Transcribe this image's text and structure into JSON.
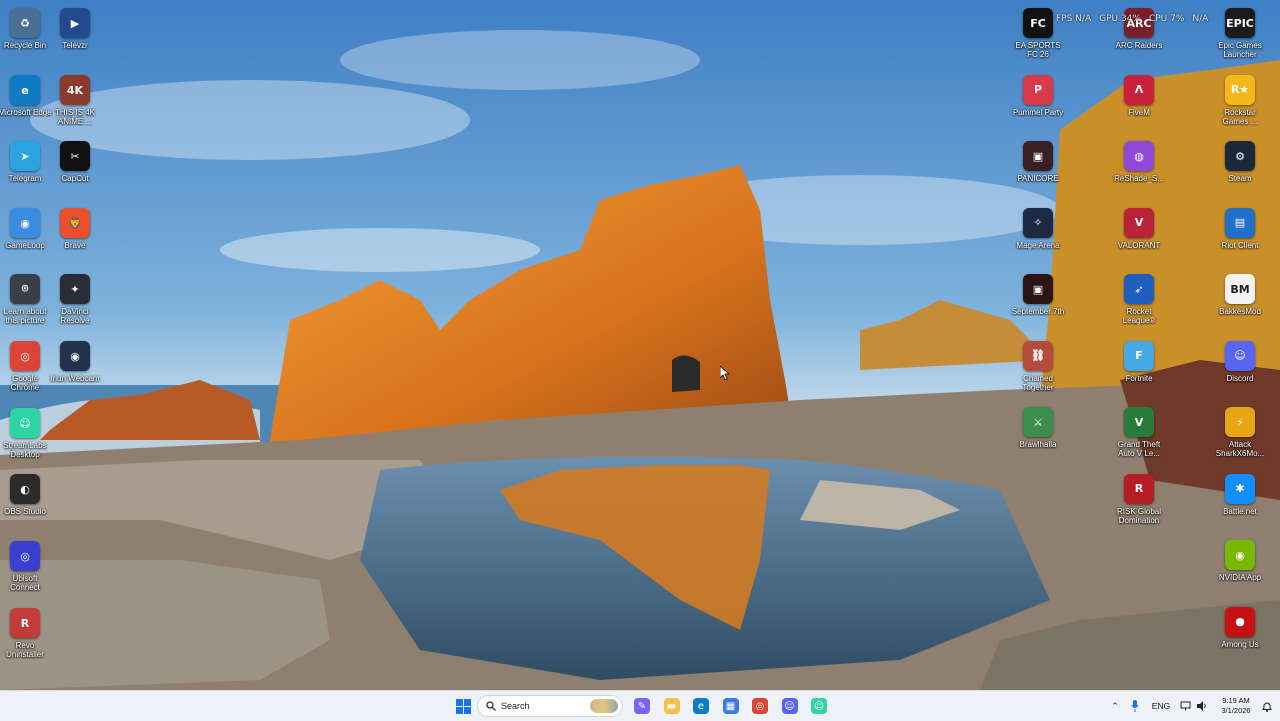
{
  "desktop": {
    "icons_left": [
      {
        "label": "Recycle Bin",
        "icon": "recycle-bin-icon",
        "color": "#4a6f92",
        "glyph": "♻"
      },
      {
        "label": "Televzr",
        "icon": "televzr-icon",
        "color": "#234a8c",
        "glyph": "▶"
      },
      {
        "label": "Microsoft Edge",
        "icon": "edge-icon",
        "color": "#0f7bc4",
        "glyph": "e"
      },
      {
        "label": "THIS IS 4K ANIME ...",
        "icon": "anime-video-icon",
        "color": "#8a3b2c",
        "glyph": "4K"
      },
      {
        "label": "Telegram",
        "icon": "telegram-icon",
        "color": "#2aa3de",
        "glyph": "➤"
      },
      {
        "label": "CapCut",
        "icon": "capcut-icon",
        "color": "#111111",
        "glyph": "✂"
      },
      {
        "label": "GameLoop",
        "icon": "gameloop-icon",
        "color": "#3b8be0",
        "glyph": "◉"
      },
      {
        "label": "Brave",
        "icon": "brave-icon",
        "color": "#e8502d",
        "glyph": "🦁"
      },
      {
        "label": "Learn about this picture",
        "icon": "camera-icon",
        "color": "#3a3f47",
        "glyph": "⌾"
      },
      {
        "label": "DaVinci Resolve",
        "icon": "davinci-resolve-icon",
        "color": "#2c2c38",
        "glyph": "✦"
      },
      {
        "label": "Google Chrome",
        "icon": "chrome-icon",
        "color": "#db4437",
        "glyph": "◎"
      },
      {
        "label": "Iriun Webcam",
        "icon": "webcam-icon",
        "color": "#22324a",
        "glyph": "◉"
      },
      {
        "label": "StreamLabs Desktop",
        "icon": "streamlabs-icon",
        "color": "#2fd4a3",
        "glyph": "☺"
      },
      {
        "label": "OBS Studio",
        "icon": "obs-icon",
        "color": "#2b2b2b",
        "glyph": "◐"
      },
      {
        "label": "Ubisoft Connect",
        "icon": "ubisoft-icon",
        "color": "#3a3fd0",
        "glyph": "◎"
      },
      {
        "label": "Revo Uninstaller",
        "icon": "revo-uninstaller-icon",
        "color": "#c43b3b",
        "glyph": "R"
      }
    ],
    "icons_right": [
      {
        "label": "EA SPORTS FC 26",
        "icon": "ea-fc-icon",
        "color": "#111111",
        "glyph": "FC"
      },
      {
        "label": "ARC Raiders",
        "icon": "arc-raiders-icon",
        "color": "#7a1f2a",
        "glyph": "ARC"
      },
      {
        "label": "Epic Games Launcher",
        "icon": "epic-games-icon",
        "color": "#1b1b1b",
        "glyph": "EPIC"
      },
      {
        "label": "Pummel Party",
        "icon": "pummel-party-icon",
        "color": "#d83a4a",
        "glyph": "P"
      },
      {
        "label": "FiveM",
        "icon": "fivem-icon",
        "color": "#c8203a",
        "glyph": "Λ"
      },
      {
        "label": "Rockstar Games ...",
        "icon": "rockstar-icon",
        "color": "#f2b71a",
        "glyph": "R★"
      },
      {
        "label": "PANICORE",
        "icon": "panicore-icon",
        "color": "#3a2020",
        "glyph": "▣"
      },
      {
        "label": "ReShade_S...",
        "icon": "reshade-icon",
        "color": "#8c4ad6",
        "glyph": "◍"
      },
      {
        "label": "Steam",
        "icon": "steam-icon",
        "color": "#1b2838",
        "glyph": "⚙"
      },
      {
        "label": "Mage Arena",
        "icon": "mage-arena-icon",
        "color": "#1e2a44",
        "glyph": "✧"
      },
      {
        "label": "VALORANT",
        "icon": "valorant-icon",
        "color": "#b8233a",
        "glyph": "V"
      },
      {
        "label": "Riot Client",
        "icon": "riot-client-icon",
        "color": "#2270c9",
        "glyph": "▤"
      },
      {
        "label": "September 7th",
        "icon": "september-7th-icon",
        "color": "#2a1414",
        "glyph": "▣"
      },
      {
        "label": "Rocket League®",
        "icon": "rocket-league-icon",
        "color": "#1e5fbd",
        "glyph": "➶"
      },
      {
        "label": "BakkesMod",
        "icon": "bakkesmod-icon",
        "color": "#f4f4f4",
        "glyph": "BM"
      },
      {
        "label": "Chained Together",
        "icon": "chained-together-icon",
        "color": "#b84a3c",
        "glyph": "⛓"
      },
      {
        "label": "Fortnite",
        "icon": "fortnite-icon",
        "color": "#46a8e6",
        "glyph": "F"
      },
      {
        "label": "Discord",
        "icon": "discord-icon",
        "color": "#5865f2",
        "glyph": "☺"
      },
      {
        "label": "Brawlhalla",
        "icon": "brawlhalla-icon",
        "color": "#3c8f4a",
        "glyph": "⚔"
      },
      {
        "label": "Grand Theft Auto V Le...",
        "icon": "gta-v-icon",
        "color": "#2a7a3a",
        "glyph": "V"
      },
      {
        "label": "Attack SharkX6Mo...",
        "icon": "attack-shark-icon",
        "color": "#e8a615",
        "glyph": "⚡"
      },
      {
        "label": "RISK Global Domination",
        "icon": "risk-icon",
        "color": "#b61d24",
        "glyph": "R"
      },
      {
        "label": "Battle.net",
        "icon": "battlenet-icon",
        "color": "#148eff",
        "glyph": "✱"
      },
      {
        "label": "NVIDIA App",
        "icon": "nvidia-icon",
        "color": "#76b900",
        "glyph": "◉"
      },
      {
        "label": "Among Us",
        "icon": "among-us-icon",
        "color": "#c51111",
        "glyph": "●"
      }
    ]
  },
  "overlay": {
    "fps": "FPS N/A",
    "gpu": "GPU 34%",
    "cpu": "CPU 7%",
    "extra": "N/A"
  },
  "taskbar": {
    "search_label": "Search",
    "apps": [
      {
        "icon": "copilot-icon",
        "color": "#7b61ff",
        "glyph": "✎"
      },
      {
        "icon": "file-explorer-icon",
        "color": "#f2c14e",
        "glyph": "▬"
      },
      {
        "icon": "edge-icon",
        "color": "#0f7bc4",
        "glyph": "e"
      },
      {
        "icon": "microsoft-store-icon",
        "color": "#3a7bd5",
        "glyph": "▦"
      },
      {
        "icon": "chrome-icon",
        "color": "#db4437",
        "glyph": "◎"
      },
      {
        "icon": "discord-icon",
        "color": "#5865f2",
        "glyph": "☺"
      },
      {
        "icon": "streamlabs-icon",
        "color": "#2fd4a3",
        "glyph": "☺"
      }
    ],
    "tray": {
      "language": "ENG",
      "time": "9:19 AM",
      "date": "3/1/2026"
    }
  }
}
